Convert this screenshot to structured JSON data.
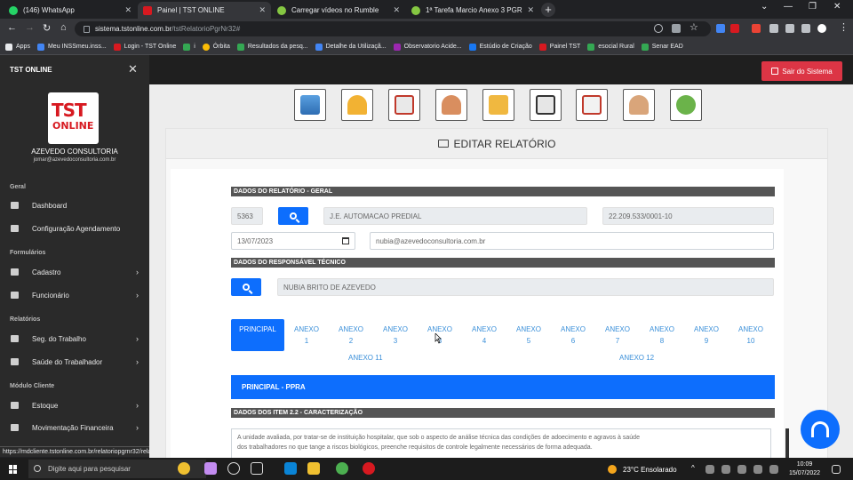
{
  "browser": {
    "tabs": [
      {
        "label": "(146) WhatsApp",
        "icon": "whatsapp-icon",
        "color": "#25d366"
      },
      {
        "label": "Painel | TST ONLINE",
        "icon": "tst-icon",
        "color": "#d71920"
      },
      {
        "label": "Carregar vídeos no Rumble",
        "icon": "rumble-icon",
        "color": "#85c742"
      },
      {
        "label": "1ª Tarefa Marcio Anexo 3 PGR",
        "icon": "rumble-icon",
        "color": "#85c742"
      }
    ],
    "url_host": "sistema.tstonline.com.br",
    "url_path": "/tstRelatorioPgrNr32#",
    "bookmarks": [
      {
        "label": "Apps",
        "color": "#e8eaed"
      },
      {
        "label": "Meu INSSmeu.inss...",
        "color": "#4285f4"
      },
      {
        "label": "Login - TST Online",
        "color": "#d71920"
      },
      {
        "label": "i",
        "color": "#34a853"
      },
      {
        "label": "Órbita",
        "color": "#fbbc05"
      },
      {
        "label": "Resultados da pesq...",
        "color": "#34a853"
      },
      {
        "label": "Detalhe da Utilizaçã...",
        "color": "#4285f4"
      },
      {
        "label": "Observatorio Acide...",
        "color": "#9c27b0"
      },
      {
        "label": "Estúdio de Criação",
        "color": "#1877f2"
      },
      {
        "label": "Painel TST",
        "color": "#d71920"
      },
      {
        "label": "esocial Rural",
        "color": "#34a853"
      },
      {
        "label": "Senar EAD",
        "color": "#34a853"
      }
    ],
    "status_url": "https://mdcliente.tstonline.com.br/relatoriopgrnr32/relatorioPgrNr32AddEdit/5363#pills-ane..."
  },
  "sidebar": {
    "title": "TST ONLINE",
    "logo_line1": "TST",
    "logo_line2": "ONLINE",
    "company": "AZEVEDO CONSULTORIA",
    "email": "jomar@azevedoconsultoria.com.br",
    "sections": [
      {
        "label": "Geral",
        "items": [
          {
            "label": "Dashboard",
            "icon": "dashboard-icon",
            "chevron": false
          },
          {
            "label": "Configuração Agendamento",
            "icon": "calendar-icon",
            "chevron": false
          }
        ]
      },
      {
        "label": "Formulários",
        "items": [
          {
            "label": "Cadastro",
            "icon": "folder-icon",
            "chevron": true
          },
          {
            "label": "Funcionário",
            "icon": "folder-icon",
            "chevron": true
          }
        ]
      },
      {
        "label": "Relatórios",
        "items": [
          {
            "label": "Seg. do Trabalho",
            "icon": "user-icon",
            "chevron": true
          },
          {
            "label": "Saúde do Trabalhador",
            "icon": "plus-box-icon",
            "chevron": true
          }
        ]
      },
      {
        "label": "Módulo Cliente",
        "items": [
          {
            "label": "Estoque",
            "icon": "box-icon",
            "chevron": true
          },
          {
            "label": "Movimentação Financeira",
            "icon": "money-icon",
            "chevron": true
          }
        ]
      }
    ]
  },
  "header": {
    "logout_label": "Sair do Sistema",
    "module_icons": [
      "building-icon",
      "helmet-icon",
      "medical-report-icon",
      "doctor-icon",
      "folder-search-icon",
      "clipboard-icon",
      "clipboard-plus-icon",
      "physician-icon",
      "hands-plant-icon"
    ]
  },
  "form": {
    "title": "EDITAR RELATÓRIO",
    "section_general": "DADOS DO RELATÓRIO - GERAL",
    "company_code": "5363",
    "company_name": "J.E. AUTOMACAO PREDIAL",
    "cnpj": "22.209.533/0001-10",
    "date": "13/07/2023",
    "email": "nubia@azevedoconsultoria.com.br",
    "section_responsible": "DADOS DO RESPONSÁVEL TÉCNICO",
    "responsible_name": "NUBIA BRITO DE AZEVEDO",
    "tabs": [
      {
        "l1": "PRINCIPAL",
        "l2": ""
      },
      {
        "l1": "ANEXO",
        "l2": "1"
      },
      {
        "l1": "ANEXO",
        "l2": "2"
      },
      {
        "l1": "ANEXO",
        "l2": "3"
      },
      {
        "l1": "ANEXO",
        "l2": "3"
      },
      {
        "l1": "ANEXO",
        "l2": "4"
      },
      {
        "l1": "ANEXO",
        "l2": "5"
      },
      {
        "l1": "ANEXO",
        "l2": "6"
      },
      {
        "l1": "ANEXO",
        "l2": "7"
      },
      {
        "l1": "ANEXO",
        "l2": "8"
      },
      {
        "l1": "ANEXO",
        "l2": "9"
      },
      {
        "l1": "ANEXO",
        "l2": "10"
      }
    ],
    "tabs_row2": [
      "ANEXO 11",
      "ANEXO 12"
    ],
    "principal_bar": "PRINCIPAL - PPRA",
    "section_item": "DADOS DOS ITEM 2.2 - CARACTERIZAÇÃO",
    "description_line1": "A unidade avaliada, por tratar-se de instituição hospitalar, que sob o aspecto de análise técnica das condições de adoecimento e agravos à saúde",
    "description_line2": "dos trabalhadores no que tange a riscos biológicos, preenche requisitos de controle legalmente necessários de forma adequada."
  },
  "taskbar": {
    "search_placeholder": "Digite aqui para pesquisar",
    "weather": "23°C  Ensolarado",
    "time": "10:09",
    "date": "15/07/2022"
  }
}
